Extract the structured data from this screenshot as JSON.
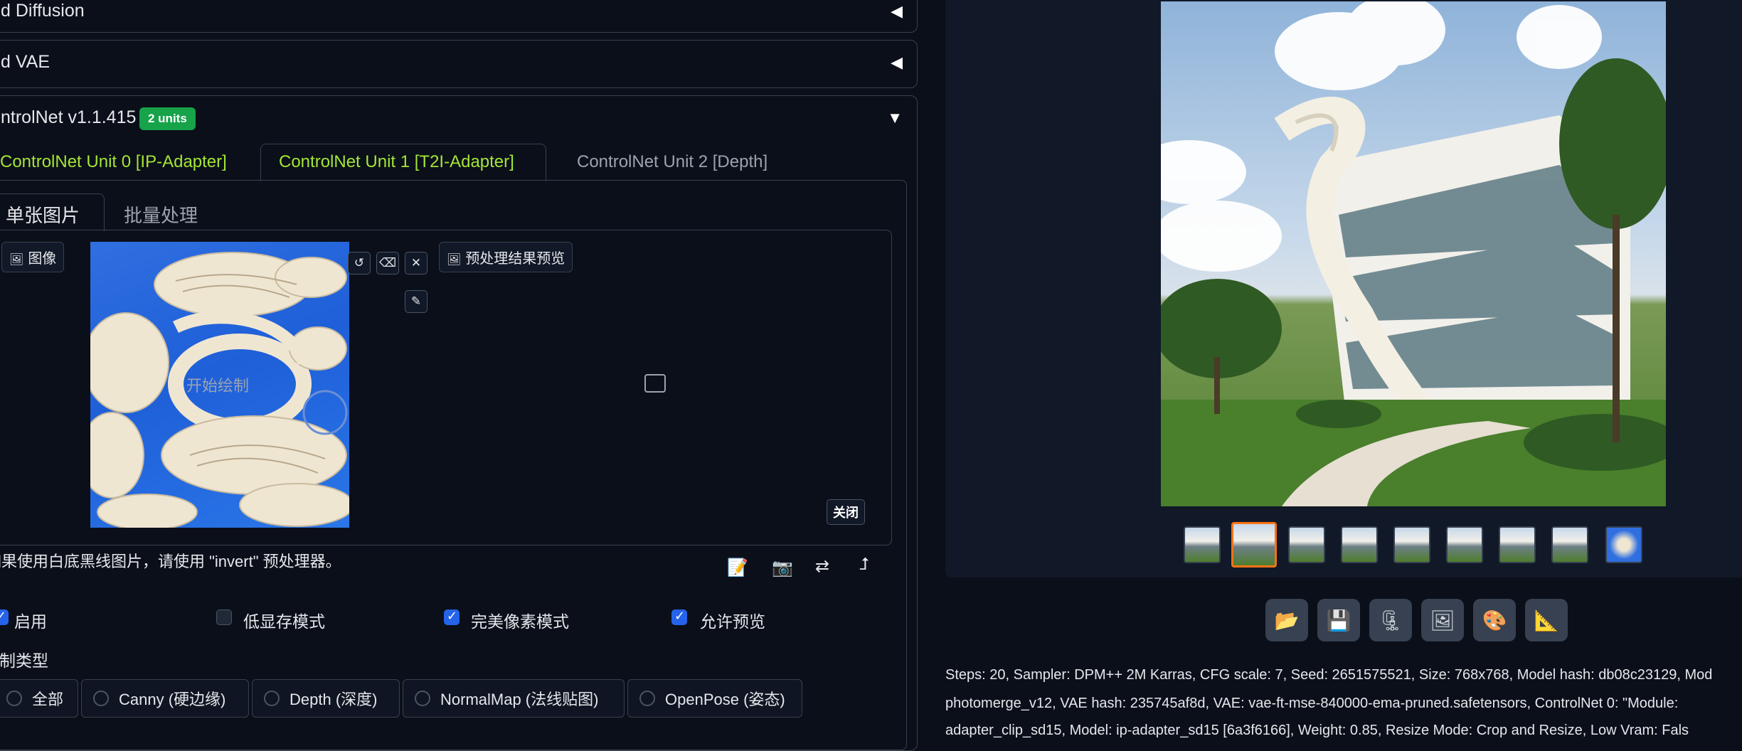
{
  "accordions": {
    "diffusion_title": "d Diffusion",
    "vae_title": "d VAE",
    "controlnet_title": "ntrolNet v1.1.415",
    "controlnet_badge": "2 units"
  },
  "unit_tabs": [
    {
      "label": "ControlNet Unit 0 [IP-Adapter]"
    },
    {
      "label": "ControlNet Unit 1 [T2I-Adapter]"
    },
    {
      "label": "ControlNet Unit 2 [Depth]"
    }
  ],
  "image_tabs": {
    "single": "单张图片",
    "batch": "批量处理"
  },
  "image_panel": {
    "image_label": "图像",
    "start_draw_hint": "开始绘制",
    "preview_label": "预处理结果预览",
    "close_label": "关闭"
  },
  "hint_text": "如果使用白底黑线图片，请使用 \"invert\" 预处理器。",
  "checkboxes": [
    {
      "label": "启用",
      "checked": true
    },
    {
      "label": "低显存模式",
      "checked": false
    },
    {
      "label": "完美像素模式",
      "checked": true
    },
    {
      "label": "允许预览",
      "checked": true
    }
  ],
  "control_type": {
    "label": "控制类型",
    "options": [
      {
        "label": "全部"
      },
      {
        "label": "Canny (硬边缘)"
      },
      {
        "label": "Depth (深度)"
      },
      {
        "label": "NormalMap (法线贴图)"
      },
      {
        "label": "OpenPose (姿态)"
      }
    ]
  },
  "gallery": {
    "thumb_count": 9,
    "selected_index": 1
  },
  "action_icons": [
    "folder-icon",
    "save-icon",
    "zip-icon",
    "image-icon",
    "palette-icon",
    "ruler-icon"
  ],
  "generation_info": {
    "line1": "Steps: 20, Sampler: DPM++ 2M Karras, CFG scale: 7, Seed: 2651575521, Size: 768x768, Model hash: db08c23129, Mod",
    "line2": "photomerge_v12, VAE hash: 235745af8d, VAE: vae-ft-mse-840000-ema-pruned.safetensors, ControlNet 0: \"Module:",
    "line3": "adapter_clip_sd15, Model: ip-adapter_sd15 [6a3f6166], Weight: 0.85, Resize Mode: Crop and Resize, Low Vram: Fals"
  },
  "colors": {
    "background": "#0b0f19",
    "accent_green": "#a3e635",
    "checkbox_blue": "#2563eb",
    "selected_thumb": "#f97316"
  }
}
